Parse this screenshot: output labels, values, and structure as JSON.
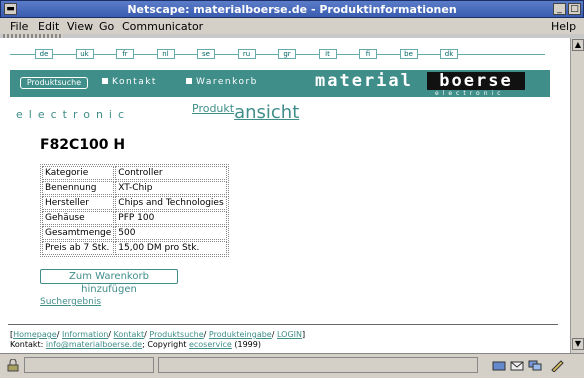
{
  "window": {
    "title": "Netscape: materialboerse.de - Produktinformationen"
  },
  "menu": {
    "file": "File",
    "edit": "Edit",
    "view": "View",
    "go": "Go",
    "communicator": "Communicator",
    "help": "Help"
  },
  "languages": [
    "de",
    "uk",
    "fr",
    "nl",
    "se",
    "ru",
    "gr",
    "it",
    "fi",
    "be",
    "dk"
  ],
  "nav": {
    "produktsuche": "Produktsuche",
    "kontakt": "Kontakt",
    "warenkorb": "Warenkorb",
    "logo_main": "material",
    "logo_box": "boerse",
    "logo_sub": "electronic"
  },
  "section": {
    "electronic": "electronic",
    "title_small": "Produkt",
    "title_large": "ansicht"
  },
  "product": {
    "name": "F82C100 H",
    "rows": [
      {
        "key": "Kategorie",
        "value": "Controller"
      },
      {
        "key": "Benennung",
        "value": "XT-Chip"
      },
      {
        "key": "Hersteller",
        "value": "Chips and Technologies"
      },
      {
        "key": "Gehäuse",
        "value": "PFP 100"
      },
      {
        "key": "Gesamtmenge",
        "value": "500"
      },
      {
        "key": "Preis ab 7 Stk.",
        "value": "15,00 DM pro Stk."
      }
    ]
  },
  "actions": {
    "add_to_cart": "Zum Warenkorb hinzufügen",
    "suchergebnis": "Suchergebnis"
  },
  "footer": {
    "links": [
      "Homepage",
      "Information",
      "Kontakt",
      "Produktsuche",
      "Produkteingabe",
      "LOGIN"
    ],
    "kontakt_label": "Kontakt: ",
    "email": "info@materialboerse.de",
    "copyright_label": "; Copyright ",
    "company": "ecoservice",
    "year": " (1999)"
  },
  "colors": {
    "accent": "#3f8e8a",
    "titlebar": "#3a5cb0"
  }
}
